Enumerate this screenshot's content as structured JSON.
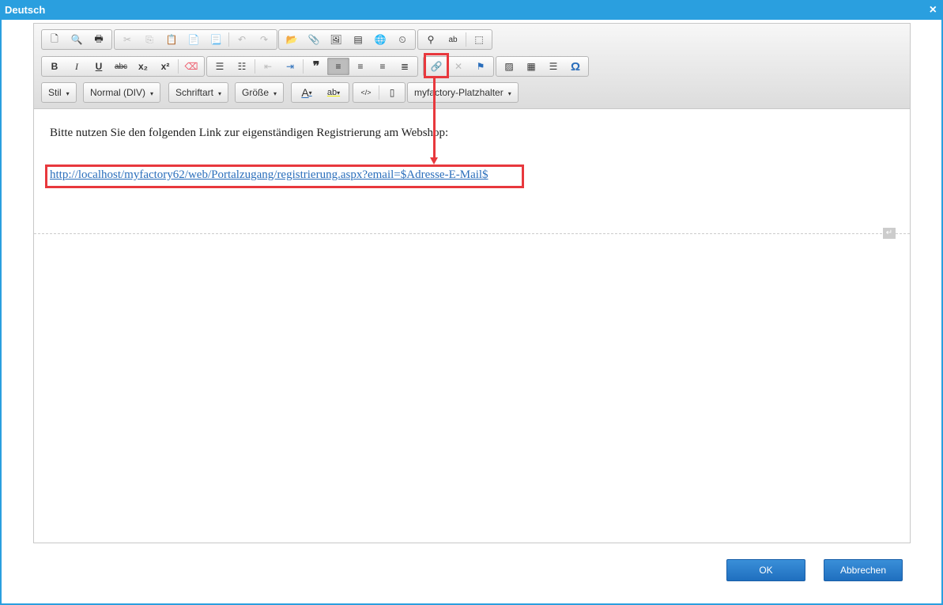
{
  "window": {
    "title": "Deutsch",
    "close": "×"
  },
  "toolbar": {
    "row3": {
      "style": "Stil",
      "format": "Normal (DIV)",
      "font": "Schriftart",
      "size": "Größe",
      "placeholder": "myfactory-Platzhalter",
      "caret": "▾"
    },
    "glyphs": {
      "bold": "B",
      "italic": "I",
      "underline": "U",
      "strike": "abc",
      "sub": "x₂",
      "sup": "x²",
      "quote": "❞",
      "omega": "Ω",
      "textcolor": "A",
      "bgcolor": "ab"
    }
  },
  "content": {
    "paragraph": "Bitte nutzen Sie den folgenden Link zur eigenständigen Registrierung am Webshop:",
    "link": "http://localhost/myfactory62/web/Portalzugang/registrierung.aspx?email=$Adresse-E-Mail$"
  },
  "buttons": {
    "ok": "OK",
    "cancel": "Abbrechen"
  }
}
